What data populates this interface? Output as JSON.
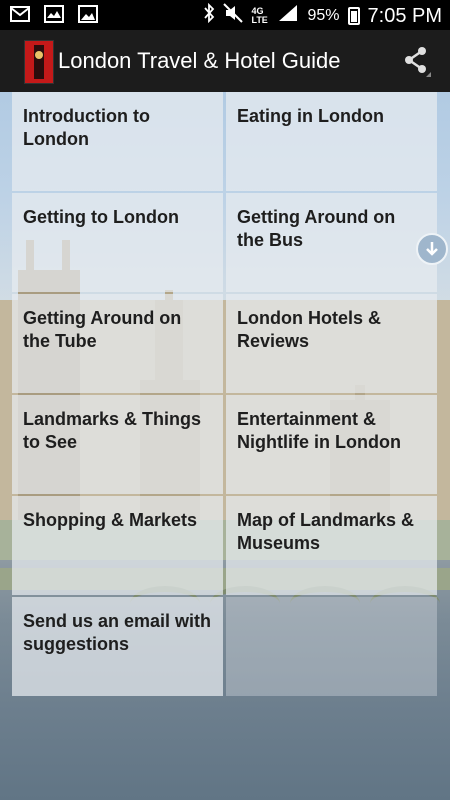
{
  "status_bar": {
    "battery": "95%",
    "time": "7:05 PM",
    "network": "4G LTE",
    "icons": [
      "mail-icon",
      "gallery-icon",
      "image-icon",
      "bluetooth-icon",
      "mute-icon",
      "signal-icon",
      "battery-icon"
    ]
  },
  "app_bar": {
    "title": "London Travel & Hotel Guide",
    "logo_icon": "big-ben-icon",
    "share_icon": "share-icon"
  },
  "menu": {
    "items": [
      {
        "label": "Introduction to London"
      },
      {
        "label": "Eating in London"
      },
      {
        "label": "Getting to London"
      },
      {
        "label": "Getting Around on the Bus"
      },
      {
        "label": "Getting Around on the Tube"
      },
      {
        "label": "London Hotels & Reviews"
      },
      {
        "label": "Landmarks & Things to See"
      },
      {
        "label": "Entertainment & Nightlife in London"
      },
      {
        "label": "Shopping & Markets"
      },
      {
        "label": "Map of Landmarks & Museums"
      },
      {
        "label": "Send us an email with suggestions"
      }
    ]
  },
  "scroll_button_icon": "arrow-down-icon"
}
